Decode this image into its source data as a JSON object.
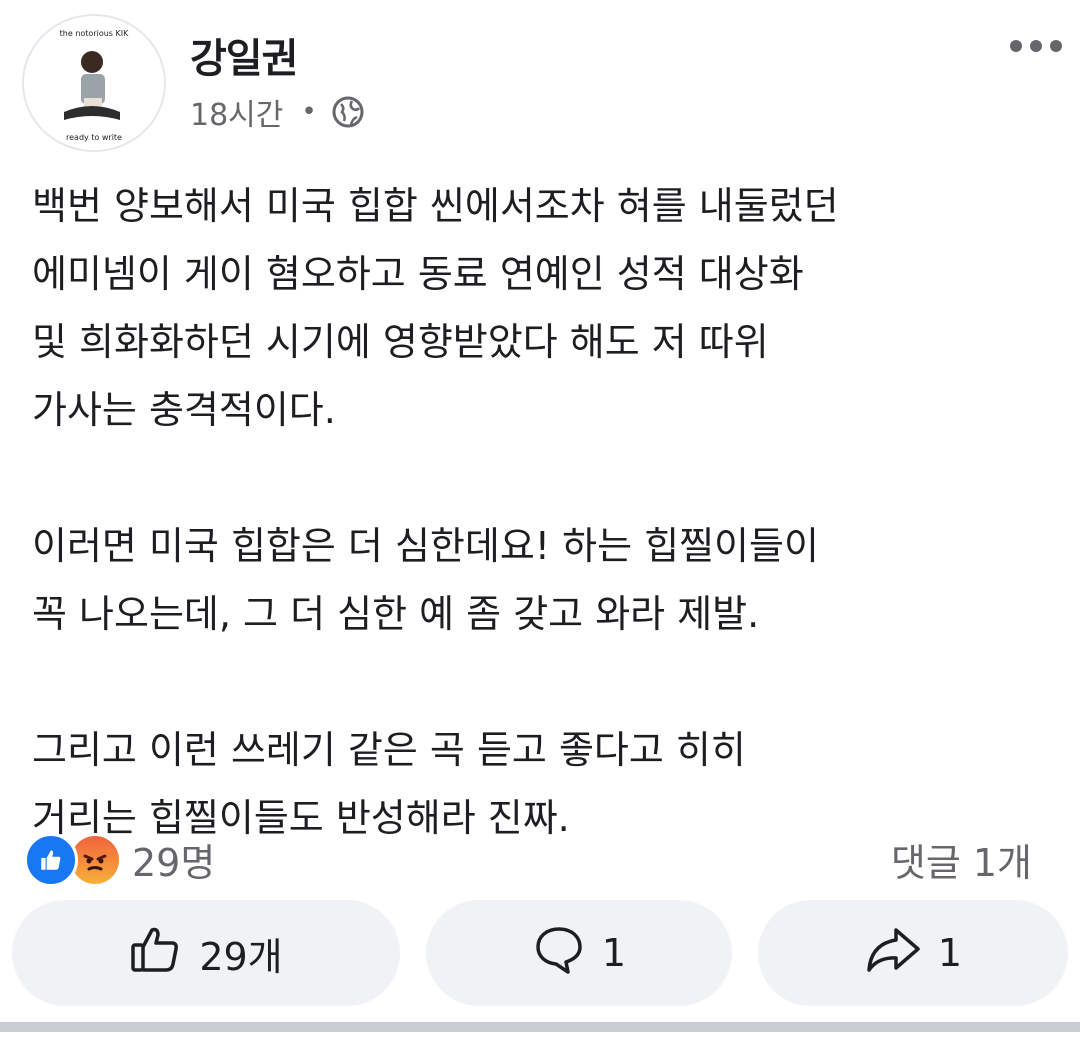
{
  "post": {
    "author": "강일권",
    "time": "18시간",
    "separator": "•",
    "privacy_icon": "globe-icon",
    "avatar_caption_top": "the notorious KIK",
    "avatar_caption_bottom": "ready to write",
    "paragraphs": [
      "백번 양보해서 미국 힙합 씬에서조차 혀를 내둘렀던\n에미넴이 게이 혐오하고 동료 연예인 성적 대상화\n및 희화화하던 시기에 영향받았다 해도 저 따위\n가사는 충격적이다.",
      "이러면 미국 힙합은 더 심한데요!  하는 힙찔이들이\n꼭 나오는데, 그 더 심한 예 좀 갖고 와라 제발.",
      "그리고 이런 쓰레기 같은 곡 듣고 좋다고 히히\n거리는 힙찔이들도 반성해라 진짜."
    ]
  },
  "stats": {
    "reaction_count": "29명",
    "reaction_icons": [
      "like-icon",
      "angry-icon"
    ],
    "comments": "댓글 1개"
  },
  "actions": {
    "like_count": "29개",
    "comment_count": "1",
    "share_count": "1"
  },
  "colors": {
    "like_blue": "#1877f2",
    "secondary_text": "#65676b",
    "button_bg": "#f0f2f5"
  }
}
